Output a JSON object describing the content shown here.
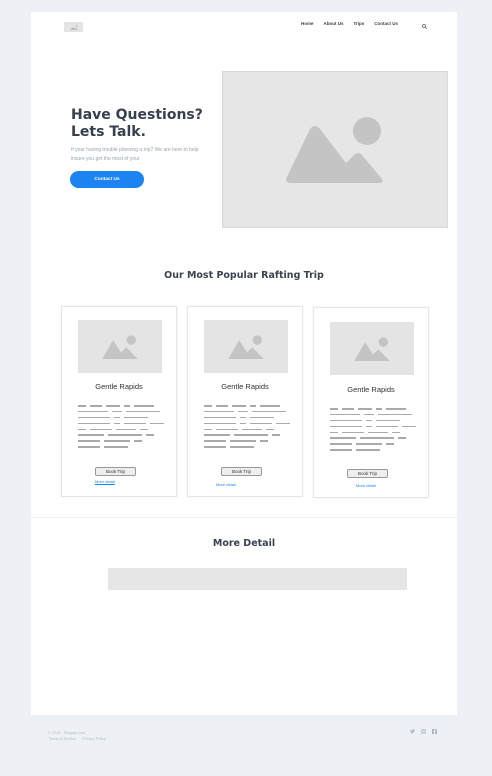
{
  "nav": {
    "items": [
      "Home",
      "About Us",
      "Trips",
      "Contact Us"
    ]
  },
  "hero": {
    "title_line1": "Have Questions?",
    "title_line2": "Lets Talk.",
    "text": "If your having trouble planning a trip? We are here to help insure you get the most of your",
    "button": "Contact Us"
  },
  "popular": {
    "title": "Our Most Popular Rafting Trip",
    "cards": [
      {
        "name": "Gentle Rapids",
        "book": "Book Trip",
        "more": "More detail"
      },
      {
        "name": "Gentle Rapids",
        "book": "Book Trip",
        "more": "More detail"
      },
      {
        "name": "Gentle Rapids",
        "book": "Book Trip",
        "more": "More detail"
      }
    ]
  },
  "more_detail": {
    "title": "More Detail"
  },
  "footer": {
    "copyright": "© 2019 - Moqups.com",
    "terms": "Terms of Service",
    "privacy": "Privacy Policy"
  },
  "colors": {
    "accent": "#1b84f0",
    "background": "#edf0f4"
  }
}
